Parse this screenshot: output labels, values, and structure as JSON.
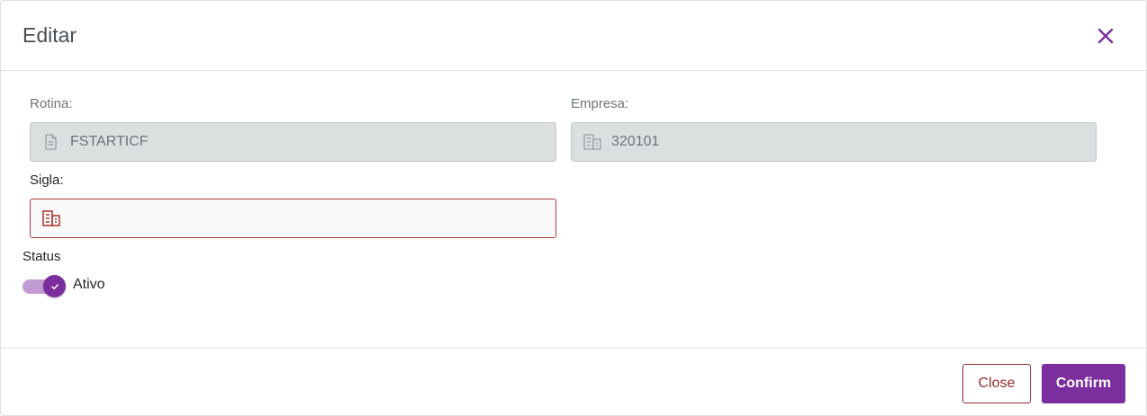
{
  "dialog": {
    "title": "Editar"
  },
  "form": {
    "rotina": {
      "label": "Rotina:",
      "value": "FSTARTICF",
      "icon": "document-icon"
    },
    "empresa": {
      "label": "Empresa:",
      "value": "320101",
      "icon": "building-icon"
    },
    "sigla": {
      "label": "Sigla:",
      "value": "",
      "icon": "building-icon"
    },
    "status": {
      "label": "Status",
      "toggle_label": "Ativo",
      "checked": true
    }
  },
  "footer": {
    "close_label": "Close",
    "confirm_label": "Confirm"
  },
  "colors": {
    "accent": "#7b2e9e",
    "error": "#b23b3b",
    "toggle_track": "#c39bd3"
  }
}
